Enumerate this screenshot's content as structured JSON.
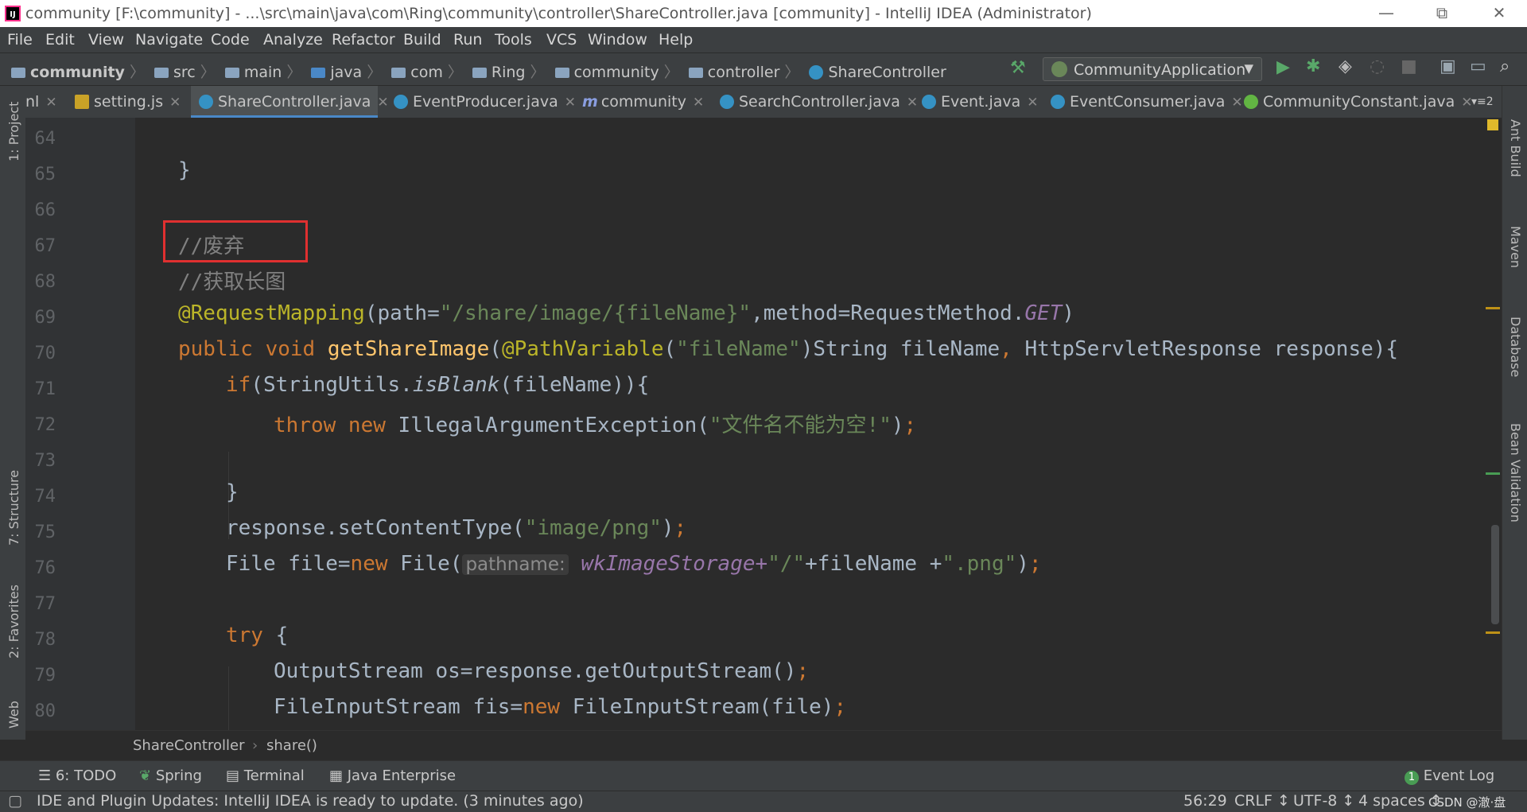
{
  "window": {
    "title": "community [F:\\community] - ...\\src\\main\\java\\com\\Ring\\community\\controller\\ShareController.java [community] - IntelliJ IDEA (Administrator)",
    "logo_text": "IJ",
    "minimize": "—",
    "restore": "⧉",
    "close": "✕"
  },
  "menu": [
    "File",
    "Edit",
    "View",
    "Navigate",
    "Code",
    "Analyze",
    "Refactor",
    "Build",
    "Run",
    "Tools",
    "VCS",
    "Window",
    "Help"
  ],
  "breadcrumb": [
    "community",
    "src",
    "main",
    "java",
    "com",
    "Ring",
    "community",
    "controller",
    "ShareController"
  ],
  "run_config": "CommunityApplication",
  "tabs": [
    "nl",
    "setting.js",
    "ShareController.java",
    "EventProducer.java",
    "community",
    "SearchController.java",
    "Event.java",
    "EventConsumer.java",
    "CommunityConstant.java"
  ],
  "tabs_overflow": "2",
  "left_tools": [
    "1: Project",
    "7: Structure",
    "2: Favorites",
    "Web"
  ],
  "right_tools": [
    "Ant Build",
    "Maven",
    "Database",
    "Bean Validation"
  ],
  "line_numbers": [
    "64",
    "65",
    "66",
    "67",
    "68",
    "69",
    "70",
    "71",
    "72",
    "73",
    "74",
    "75",
    "76",
    "77",
    "78",
    "79",
    "80"
  ],
  "code": {
    "l65": "}",
    "l67": "//废弃",
    "l68": "//获取长图",
    "l69_ann": "@RequestMapping",
    "l69_a": "(path=",
    "l69_str": "\"/share/image/{fileName}\"",
    "l69_b": ",method=RequestMethod.",
    "l69_get": "GET",
    "l69_c": ")",
    "l70_kw": "public void ",
    "l70_fn": "getShareImage",
    "l70_a": "(",
    "l70_ann": "@PathVariable",
    "l70_b": "(",
    "l70_str": "\"fileName\"",
    "l70_c": ")String fileName",
    "l70_comma": ", ",
    "l70_d": "HttpServletResponse response){",
    "l71_kw": "if",
    "l71_a": "(StringUtils.",
    "l71_it": "isBlank",
    "l71_b": "(fileName)){",
    "l72_kw": "throw new ",
    "l72_a": "IllegalArgumentException(",
    "l72_str": "\"文件名不能为空!\"",
    "l72_b": ")",
    "l72_semi": ";",
    "l74": "}",
    "l75_a": "response.setContentType(",
    "l75_str": "\"image/png\"",
    "l75_b": ")",
    "l75_semi": ";",
    "l76_a": "File file=",
    "l76_kw": "new ",
    "l76_b": "File(",
    "l76_hint": "pathname:",
    "l76_c": "wkImageStorage+",
    "l76_str1": "\"/\"",
    "l76_d": "+fileName +",
    "l76_str2": "\".png\"",
    "l76_e": ")",
    "l76_semi": ";",
    "l78_kw": "try ",
    "l78_a": "{",
    "l79_a": "OutputStream os=response.getOutputStream()",
    "l79_semi": ";",
    "l80_a": "FileInputStream fis=",
    "l80_kw": "new ",
    "l80_b": "FileInputStream(file)",
    "l80_semi": ";"
  },
  "editor_breadcrumb": [
    "ShareController",
    "share()"
  ],
  "bottom_tools": [
    "6: TODO",
    "Spring",
    "Terminal",
    "Java Enterprise"
  ],
  "event_log": "Event Log",
  "event_log_count": "1",
  "status": {
    "message": "IDE and Plugin Updates: IntelliJ IDEA is ready to update. (3 minutes ago)",
    "position": "56:29",
    "line_sep": "CRLF ↕",
    "encoding": "UTF-8 ↕",
    "indent": "4 spaces ↕",
    "watermark": "CSDN @澈·盘"
  }
}
